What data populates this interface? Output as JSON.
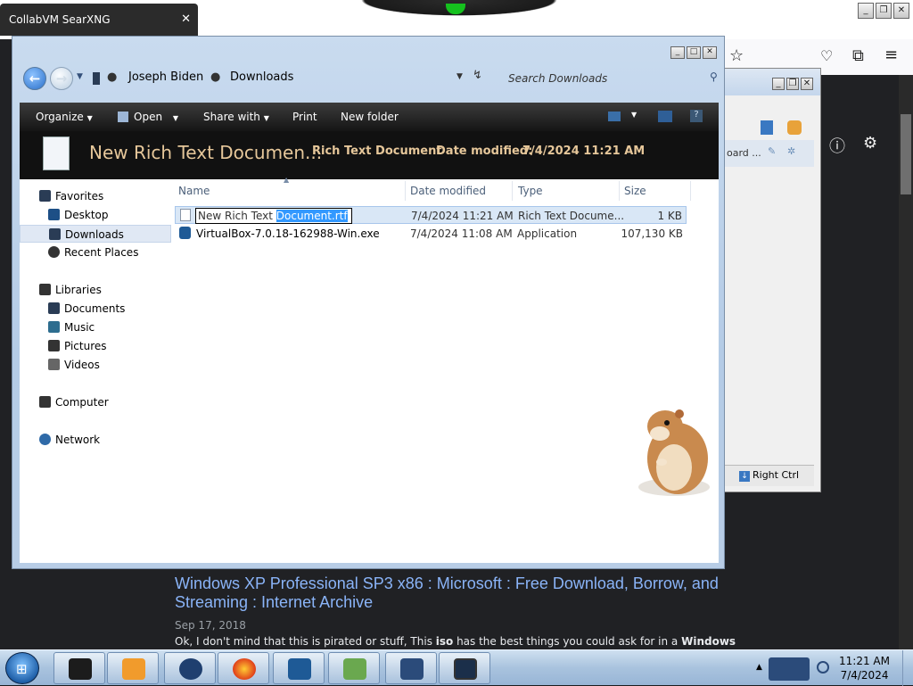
{
  "browser": {
    "tab_title": "CollabVM SearXNG",
    "tab_close": "✕",
    "result": {
      "title": "Windows XP Professional SP3 x86 : Microsoft : Free Download, Borrow, and Streaming : Internet Archive",
      "date": "Sep 17, 2018",
      "snippet_pre": "Ok, I don't mind that this is pirated or stuff, This ",
      "snippet_b1": "iso",
      "snippet_mid": " has the best things you could ask for in a ",
      "snippet_b2": "Windows"
    }
  },
  "vbox": {
    "item_label": "oard ...",
    "status_label": "Right Ctrl"
  },
  "explorer": {
    "breadcrumb": [
      "Joseph Biden",
      "Downloads"
    ],
    "search_placeholder": "Search Downloads",
    "toolbar": [
      "Organize",
      "Open",
      "Share with",
      "Print",
      "New folder"
    ],
    "details": {
      "filename": "New Rich Text Documen...",
      "filetype": "Rich Text Document",
      "date_label": "Date modified:",
      "date_value": "7/4/2024 11:21 AM"
    },
    "nav": {
      "favorites": "Favorites",
      "desktop": "Desktop",
      "downloads": "Downloads",
      "recent": "Recent Places",
      "libraries": "Libraries",
      "documents": "Documents",
      "music": "Music",
      "pictures": "Pictures",
      "videos": "Videos",
      "computer": "Computer",
      "network": "Network"
    },
    "columns": {
      "name": "Name",
      "date": "Date modified",
      "type": "Type",
      "size": "Size"
    },
    "files": [
      {
        "name_plain": "New Rich Text ",
        "name_sel": "Document.rtf",
        "date": "7/4/2024 11:21 AM",
        "type": "Rich Text Docume...",
        "size": "1 KB"
      },
      {
        "name": "VirtualBox-7.0.18-162988-Win.exe",
        "date": "7/4/2024 11:08 AM",
        "type": "Application",
        "size": "107,130 KB"
      }
    ]
  },
  "taskbar": {
    "time": "11:21 AM",
    "date": "7/4/2024",
    "apps": [
      "terminal-icon",
      "media-player-icon",
      "network-globe-icon",
      "firefox-icon",
      "virtualbox-icon",
      "control-panel-icon",
      "xp-installer-icon",
      "display-icon"
    ]
  },
  "colors": {
    "link": "#8ab4f8",
    "selection": "#3399ff",
    "details_text": "#e6c79a"
  }
}
